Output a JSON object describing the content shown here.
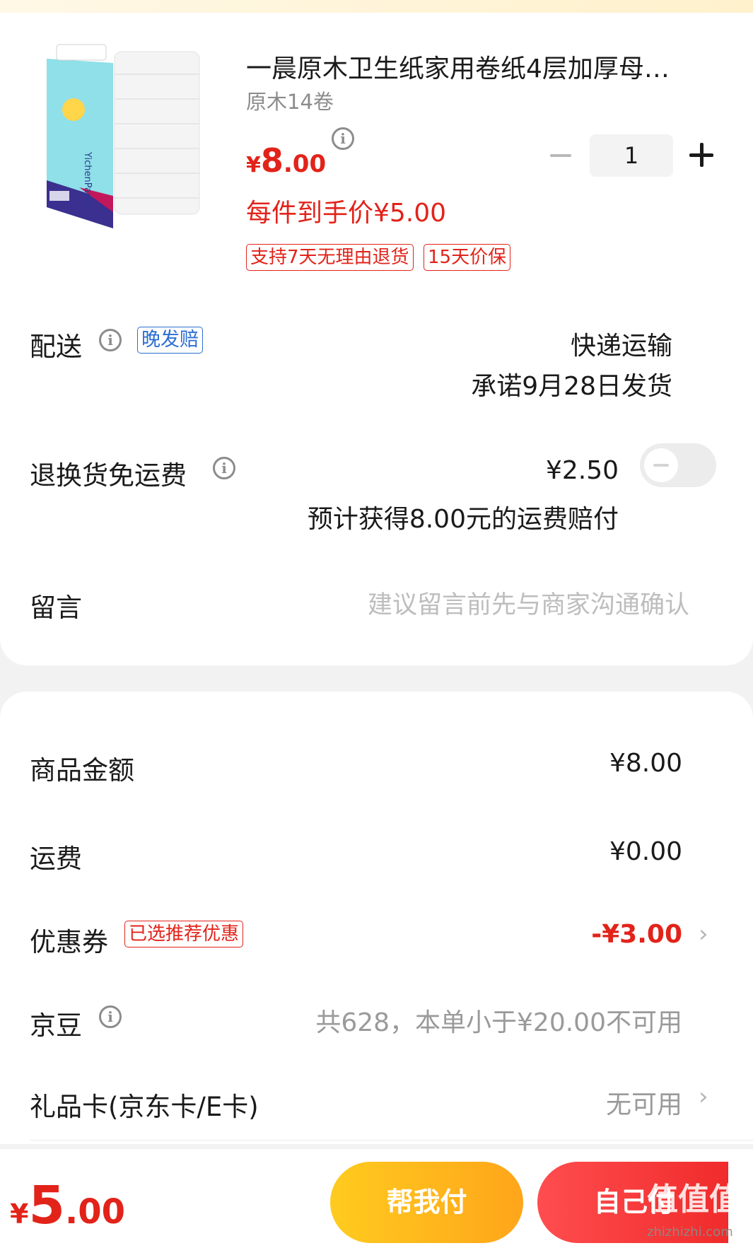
{
  "product": {
    "title": "一晨原木卫生纸家用卷纸4层加厚母…",
    "spec": "原木14卷",
    "price_currency": "¥",
    "price_int": "8",
    "price_dec": ".00",
    "final_price": "每件到手价¥5.00",
    "tags": [
      "支持7天无理由退货",
      "15天价保"
    ],
    "quantity": "1",
    "image_brand_text": "YichenPaper"
  },
  "delivery": {
    "label": "配送",
    "badge": "晚发赔",
    "method": "快递运输",
    "promise": "承诺9月28日发货"
  },
  "return_insurance": {
    "label": "退换货免运费",
    "price": "¥2.50",
    "note": "预计获得8.00元的运费赔付",
    "enabled": false
  },
  "message": {
    "label": "留言",
    "placeholder": "建议留言前先与商家沟通确认"
  },
  "summary": {
    "goods_amount_label": "商品金额",
    "goods_amount": "¥8.00",
    "shipping_label": "运费",
    "shipping": "¥0.00",
    "coupon_label": "优惠券",
    "coupon_badge": "已选推荐优惠",
    "coupon_value": "-¥3.00",
    "jingdou_label": "京豆",
    "jingdou_value": "共628，本单小于¥20.00不可用",
    "giftcard_label": "礼品卡(京东卡/E卡)",
    "giftcard_value": "无可用"
  },
  "footer": {
    "total_currency": "¥",
    "total_int": "5",
    "total_dec": ".00",
    "help_pay": "帮我付",
    "self_pay": "自己付",
    "watermark": "值值值",
    "watermark_url": "zhizhizhi.com"
  },
  "colors": {
    "accent_red": "#e2231a",
    "badge_blue": "#2b6ed2",
    "help_button": "#ffb41f",
    "self_button": "#f0353a"
  }
}
